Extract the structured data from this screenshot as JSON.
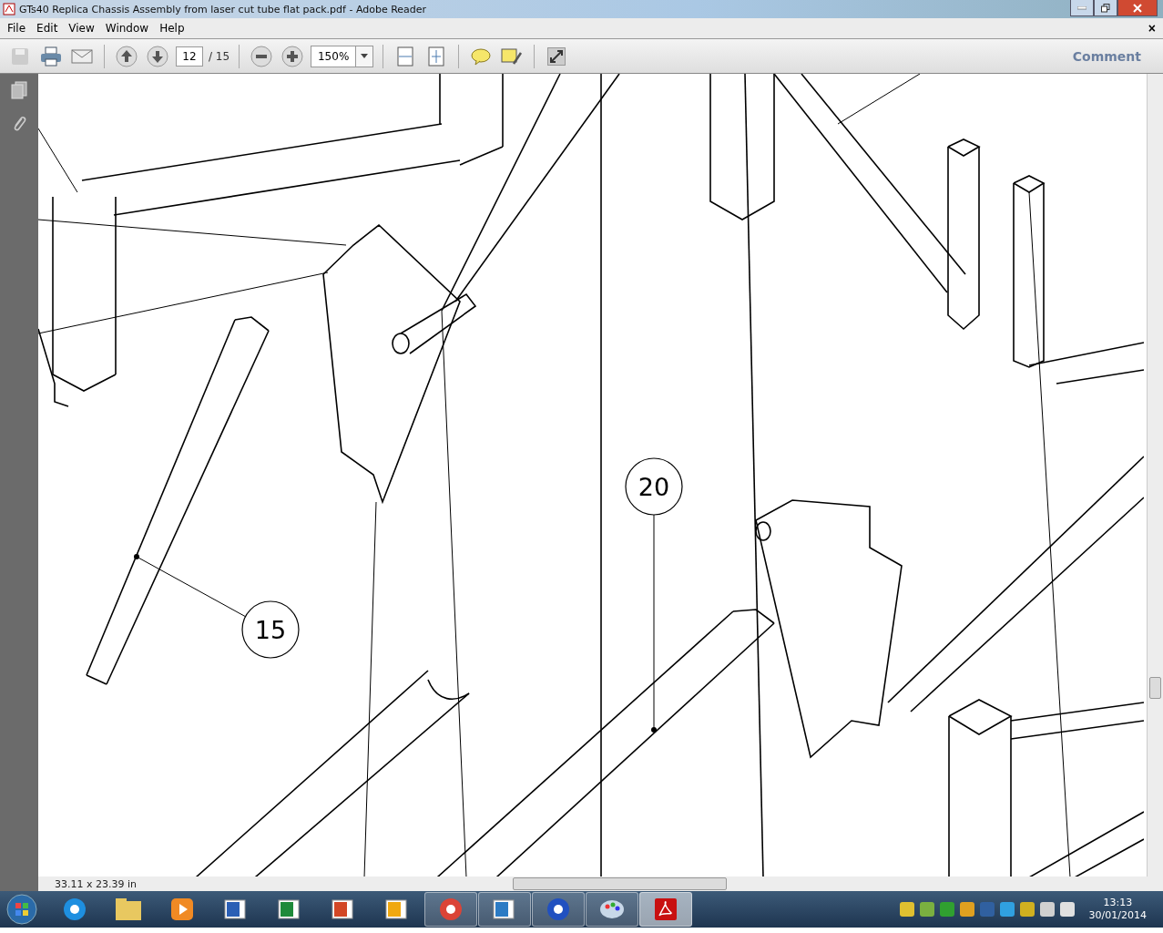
{
  "window": {
    "title": "GTs40 Replica Chassis Assembly from laser cut tube flat pack.pdf - Adobe Reader"
  },
  "menu": {
    "items": [
      "File",
      "Edit",
      "View",
      "Window",
      "Help"
    ],
    "close": "×"
  },
  "toolbar": {
    "page": "12",
    "page_count": "/ 15",
    "zoom": "150%",
    "comment": "Comment"
  },
  "document": {
    "callouts": [
      "15",
      "20"
    ]
  },
  "status_bar": {
    "page_size": "33.11 x 23.39 in"
  },
  "taskbar": {
    "apps": [
      {
        "kind": "ie",
        "running": false,
        "active": false
      },
      {
        "kind": "folder",
        "running": false,
        "active": false
      },
      {
        "kind": "media",
        "running": false,
        "active": false
      },
      {
        "kind": "word",
        "running": false,
        "active": false
      },
      {
        "kind": "excel",
        "running": false,
        "active": false
      },
      {
        "kind": "powerpoint",
        "running": false,
        "active": false
      },
      {
        "kind": "outlook",
        "running": false,
        "active": false
      },
      {
        "kind": "chrome",
        "running": true,
        "active": false
      },
      {
        "kind": "lync",
        "running": true,
        "active": false
      },
      {
        "kind": "db",
        "running": true,
        "active": false
      },
      {
        "kind": "paint",
        "running": true,
        "active": false
      },
      {
        "kind": "pdf",
        "running": true,
        "active": true
      }
    ],
    "time": "13:13",
    "date": "30/01/2014"
  }
}
